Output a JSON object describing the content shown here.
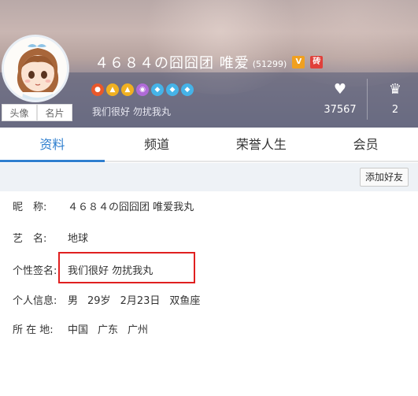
{
  "header": {
    "username": "４６８４の囧囧团 唯爱",
    "uid": "(51299)",
    "vip_label": "V",
    "badge_label": "砖",
    "signature": "我们很好 勿扰我丸",
    "avatar_tabs": [
      "头像",
      "名片"
    ],
    "medals": [
      {
        "icon": "medal-icon",
        "color": "#e8582a"
      },
      {
        "icon": "crown-icon",
        "color": "#f0b020"
      },
      {
        "icon": "crown-icon",
        "color": "#f0b020"
      },
      {
        "icon": "location-icon",
        "color": "#b06ad8"
      },
      {
        "icon": "diamond-icon",
        "color": "#45b3e8"
      },
      {
        "icon": "diamond-icon",
        "color": "#45b3e8"
      },
      {
        "icon": "diamond-icon",
        "color": "#45b3e8"
      }
    ],
    "stats": {
      "likes": "37567",
      "rank": "2"
    }
  },
  "tabs": [
    "资料",
    "频道",
    "荣誉人生",
    "会员"
  ],
  "toolbar": {
    "add_friend": "添加好友"
  },
  "info": {
    "nickname_label": "昵　称:",
    "nickname": "４６８４の囧囧团 唯爱我丸",
    "art_label": "艺　名:",
    "art_name": "地球",
    "signature_label": "个性签名:",
    "signature": "我们很好 勿扰我丸",
    "personal_label": "个人信息:",
    "gender": "男",
    "age": "29岁",
    "birthday": "2月23日",
    "zodiac": "双鱼座",
    "location_label": "所 在 地:",
    "country": "中国",
    "province": "广东",
    "city": "广州"
  },
  "colors": {
    "accent": "#2f7fcf",
    "highlight_box": "#e02020"
  }
}
